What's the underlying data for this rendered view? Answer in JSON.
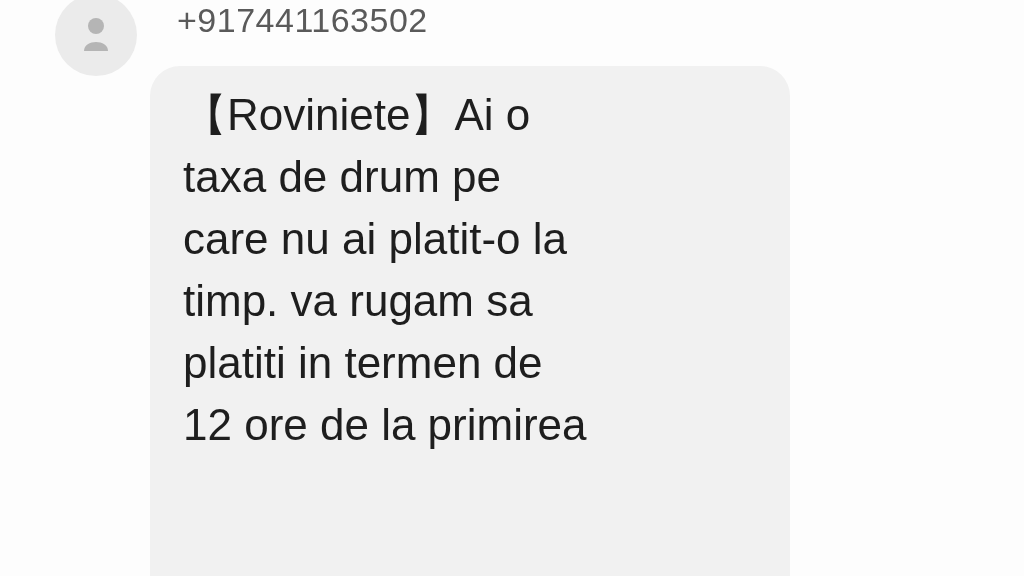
{
  "sender": {
    "phone": "+917441163502"
  },
  "message": {
    "lines": [
      "【Roviniete】Ai o",
      "taxa de drum pe",
      "care nu ai platit-o la",
      "timp. va rugam sa",
      "platiti in termen de",
      "12 ore de la primirea"
    ]
  }
}
